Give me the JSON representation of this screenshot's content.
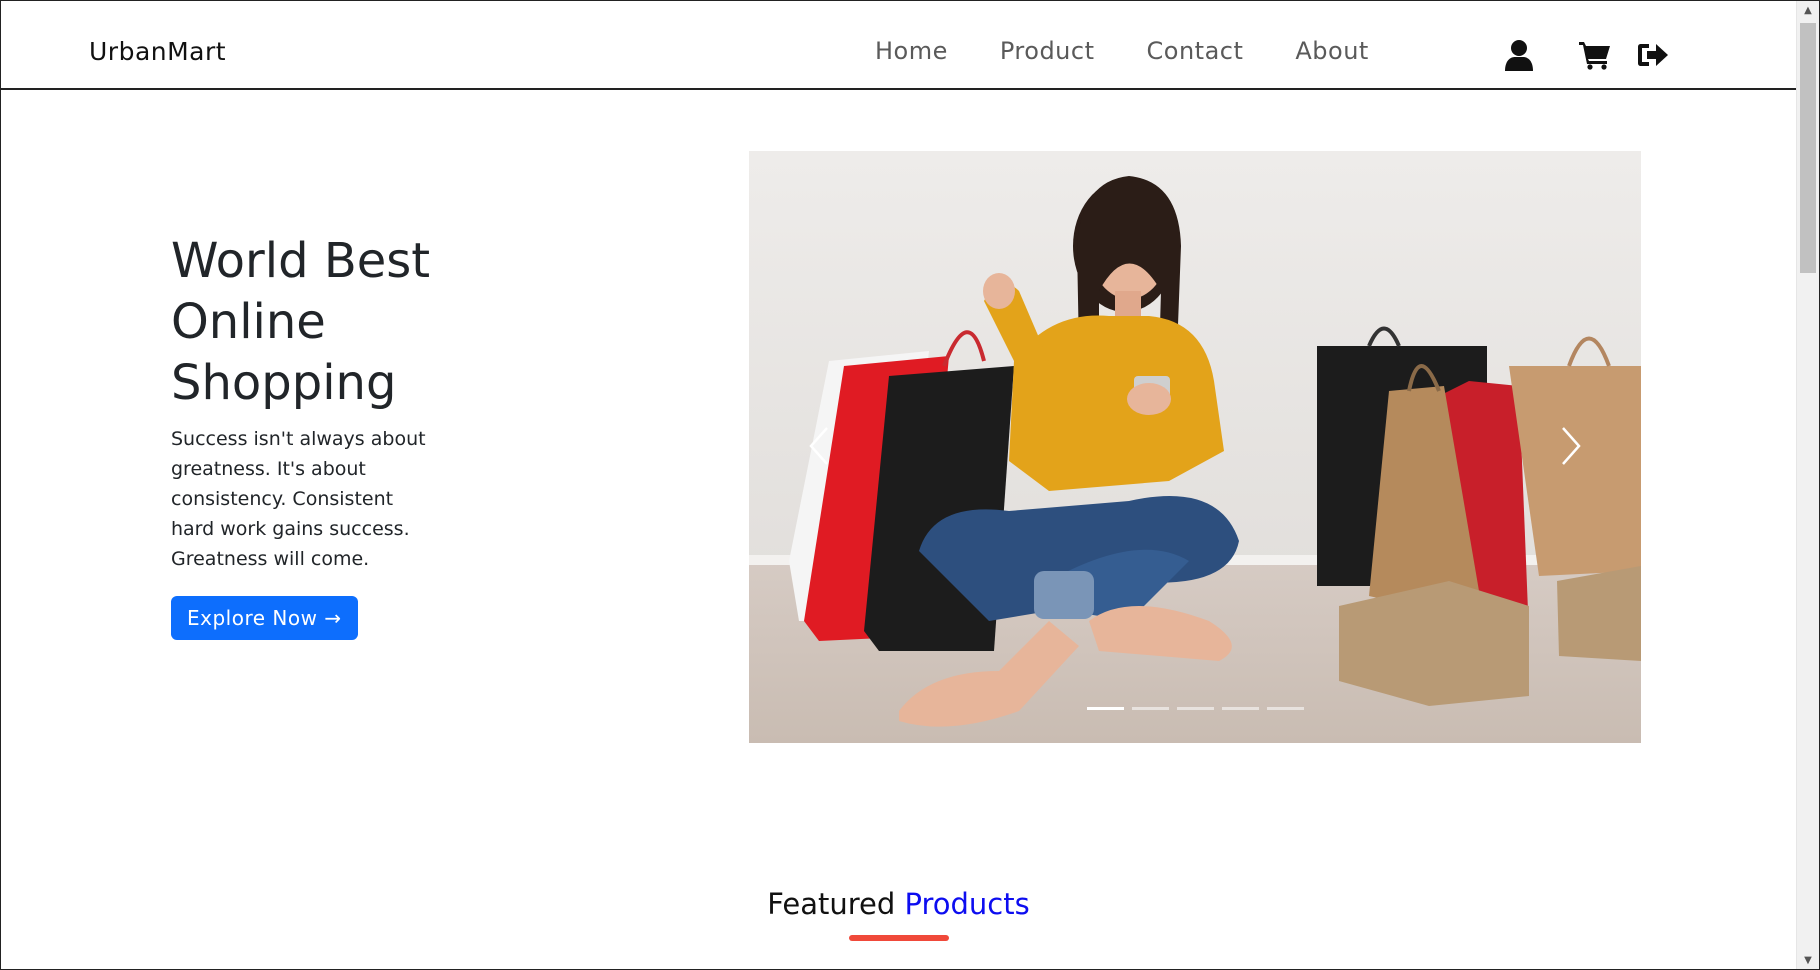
{
  "navbar": {
    "brand": "UrbanMart",
    "links": [
      {
        "label": "Home"
      },
      {
        "label": "Product"
      },
      {
        "label": "Contact"
      },
      {
        "label": "About"
      }
    ],
    "icons": [
      "user-icon",
      "cart-icon",
      "logout-icon"
    ]
  },
  "hero": {
    "title": "World Best Online Shopping",
    "description": "Success isn't always about greatness. It's about consistency. Consistent hard work gains success. Greatness will come.",
    "button_label": "Explore Now →",
    "button_color": "#0d6efd"
  },
  "carousel": {
    "slide_count": 5,
    "active_index": 0
  },
  "featured": {
    "title_part1": "Featured",
    "title_part2": "Products",
    "accent_color": "#0d0df0",
    "underline_color": "#f0493a"
  }
}
